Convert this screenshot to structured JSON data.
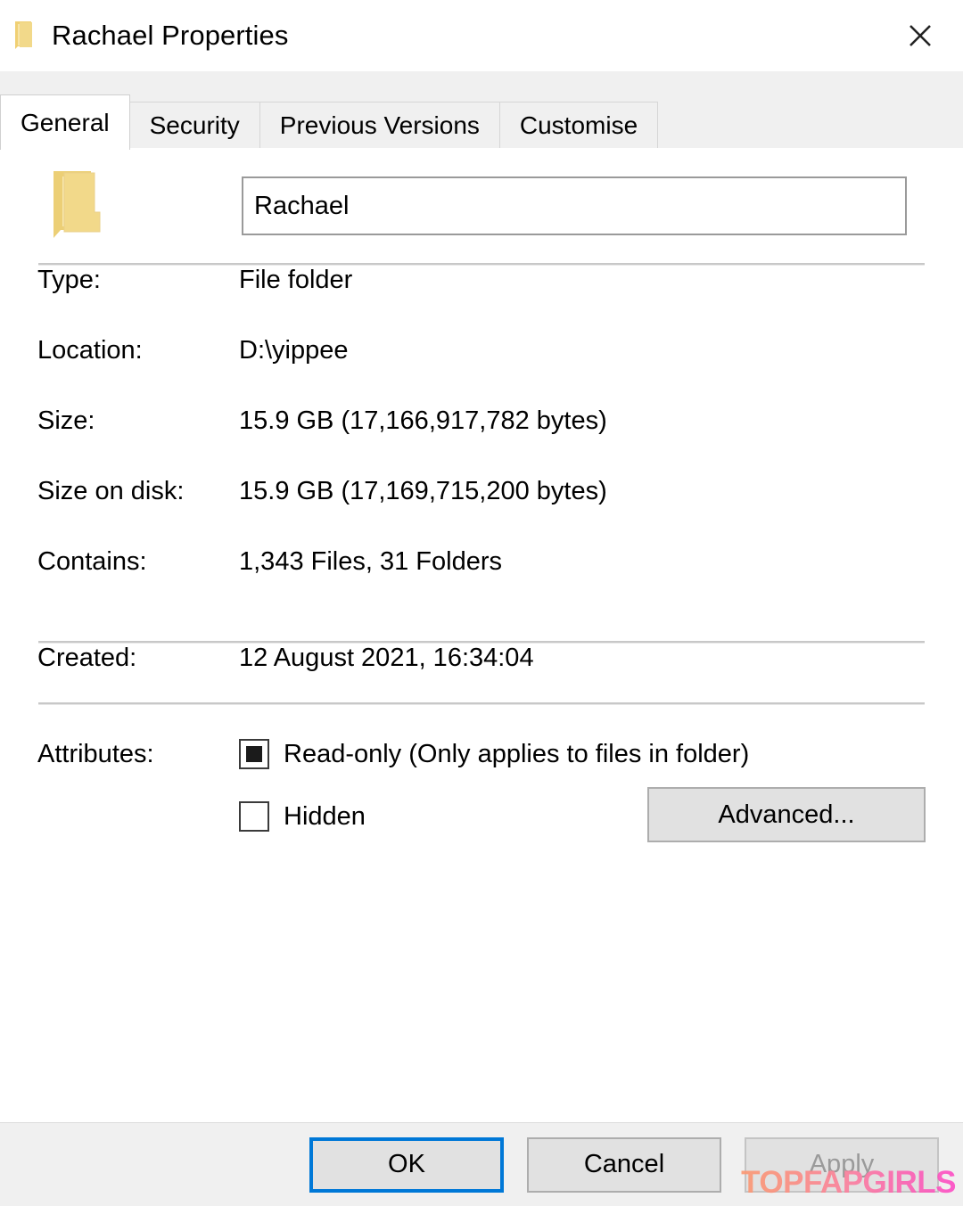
{
  "window": {
    "title": "Rachael Properties",
    "icon": "folder-icon",
    "close_label": "✕"
  },
  "tabs": [
    {
      "label": "General",
      "active": true
    },
    {
      "label": "Security",
      "active": false
    },
    {
      "label": "Previous Versions",
      "active": false
    },
    {
      "label": "Customise",
      "active": false
    }
  ],
  "general": {
    "folder_icon": "folder-icon",
    "name_value": "Rachael",
    "name_placeholder": "",
    "rows_primary": [
      {
        "label": "Type:",
        "value": "File folder"
      },
      {
        "label": "Location:",
        "value": "D:\\yippee"
      },
      {
        "label": "Size:",
        "value": "15.9 GB (17,166,917,782 bytes)"
      },
      {
        "label": "Size on disk:",
        "value": "15.9 GB (17,169,715,200 bytes)"
      },
      {
        "label": "Contains:",
        "value": "1,343 Files, 31 Folders"
      }
    ],
    "rows_secondary": [
      {
        "label": "Created:",
        "value": "12 August 2021, 16:34:04"
      }
    ],
    "attributes": {
      "label": "Attributes:",
      "readonly": {
        "label": "Read-only (Only applies to files in folder)",
        "state": "indeterminate"
      },
      "hidden": {
        "label": "Hidden",
        "state": "unchecked"
      },
      "advanced_button": "Advanced..."
    }
  },
  "footer": {
    "ok": "OK",
    "cancel": "Cancel",
    "apply": "Apply",
    "apply_disabled": true
  },
  "watermark": {
    "text": "TOPFAPGIRLS"
  },
  "colors": {
    "accent": "#0078d7",
    "dialog_bg": "#ffffff",
    "chrome_bg": "#f0f0f0",
    "button_face": "#e1e1e1",
    "button_border": "#adadad",
    "folder_yellow": "#f1d784",
    "separator": "#c8c8c8",
    "disabled_text": "#9a9a9a"
  }
}
